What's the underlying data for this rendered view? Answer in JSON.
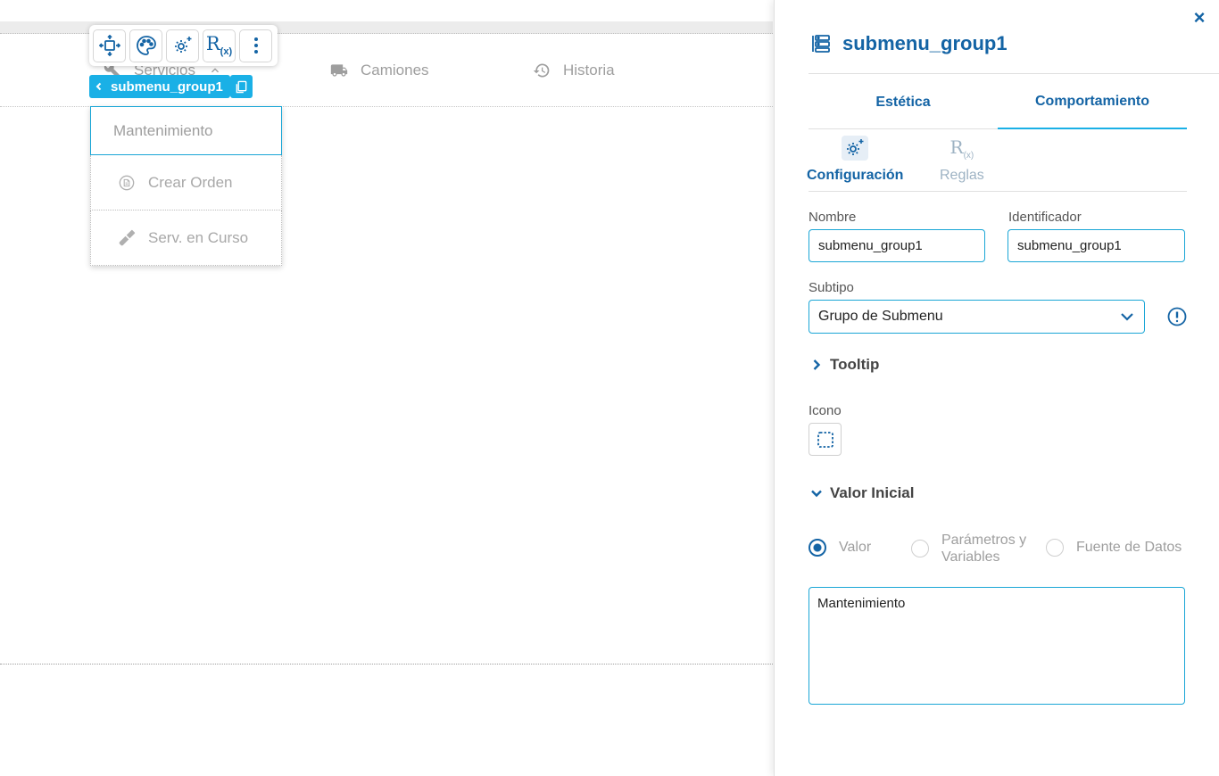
{
  "canvas": {
    "menu": [
      {
        "label": "Servicios",
        "icon": "wrench-icon"
      },
      {
        "label": "Camiones",
        "icon": "truck-icon"
      },
      {
        "label": "Historia",
        "icon": "history-icon"
      }
    ],
    "toolbar": {
      "rx_main": "R",
      "rx_sub": "(x)"
    },
    "selection_tag": "submenu_group1",
    "submenu": {
      "header": "Mantenimiento",
      "items": [
        {
          "label": "Crear Orden",
          "icon": "document-icon"
        },
        {
          "label": "Serv. en Curso",
          "icon": "wrench-icon"
        }
      ]
    }
  },
  "panel": {
    "close": "×",
    "title": "submenu_group1",
    "tabs": [
      {
        "label": "Estética",
        "active": false
      },
      {
        "label": "Comportamiento",
        "active": true
      }
    ],
    "subtabs": [
      {
        "label": "Configuración",
        "active": true
      },
      {
        "label": "Reglas",
        "active": false,
        "icon_main": "R",
        "icon_sub": "(x)"
      }
    ],
    "nombre": {
      "label": "Nombre",
      "value": "submenu_group1"
    },
    "identificador": {
      "label": "Identificador",
      "value": "submenu_group1"
    },
    "subtipo": {
      "label": "Subtipo",
      "value": "Grupo de Submenu"
    },
    "tooltip": {
      "label": "Tooltip"
    },
    "icono": {
      "label": "Icono"
    },
    "valor_inicial": {
      "label": "Valor Inicial",
      "options": [
        {
          "label": "Valor",
          "checked": true
        },
        {
          "label_line1": "Parámetros y",
          "label_line2": "Variables",
          "checked": false
        },
        {
          "label": "Fuente de Datos",
          "checked": false
        }
      ],
      "value": "Mantenimiento"
    }
  },
  "colors": {
    "primary": "#1464a5",
    "accent": "#1ab0e6",
    "muted": "#9e9e9e"
  }
}
